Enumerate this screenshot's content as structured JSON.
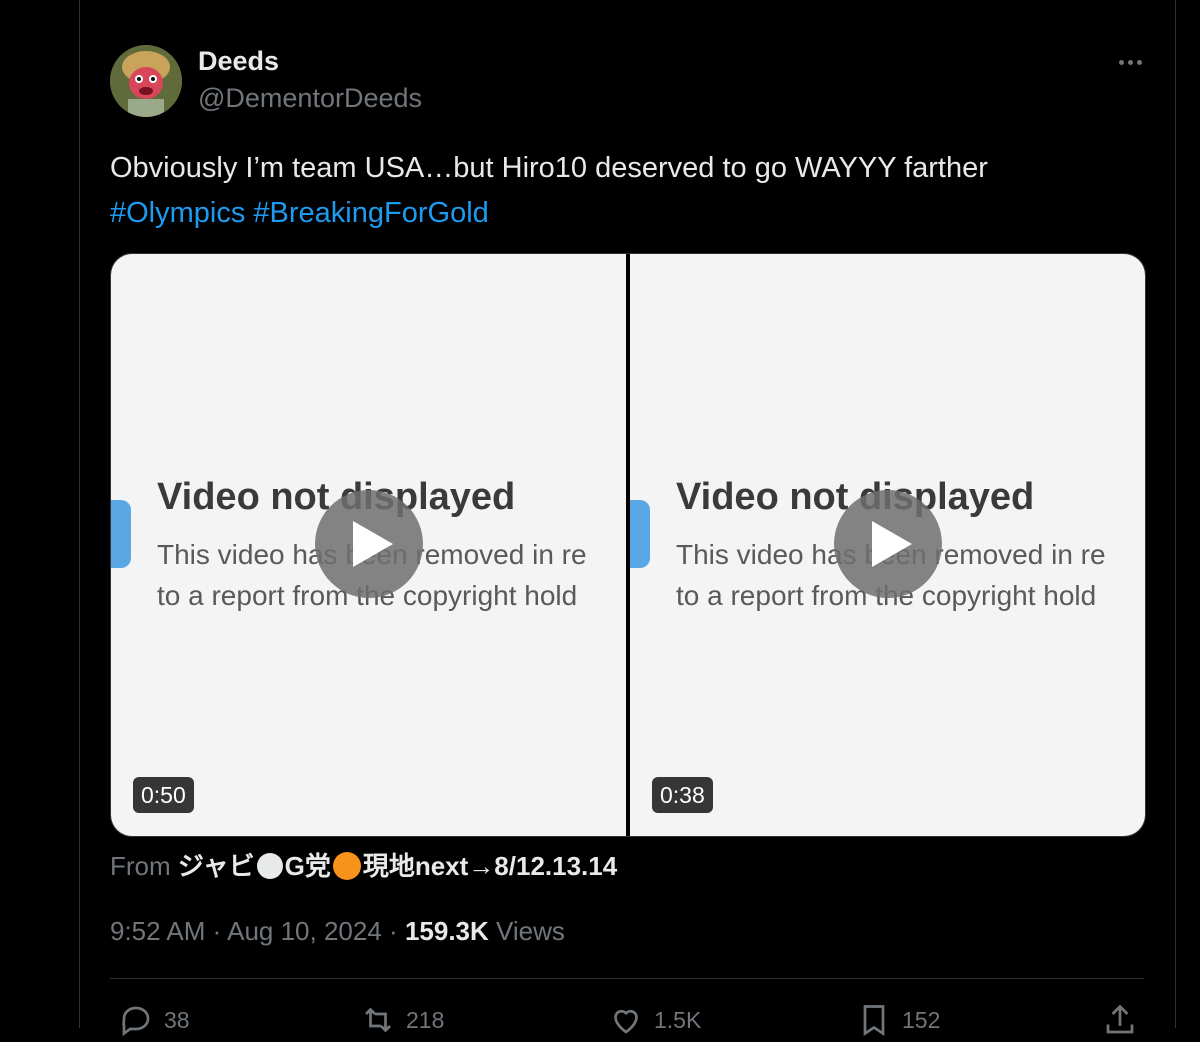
{
  "tweet": {
    "author": {
      "display_name": "Deeds",
      "handle": "@DementorDeeds"
    },
    "text": "Obviously I’m team USA…but Hiro10 deserved to go WAYYY farther",
    "hashtags": [
      "#Olympics",
      "#BreakingForGold"
    ],
    "media": [
      {
        "title": "Video not displayed",
        "body_line1": "This video has been removed in re",
        "body_line2": "to a report from the copyright hold",
        "duration": "0:50"
      },
      {
        "title": "Video not displayed",
        "body_line1": "This video has been removed in re",
        "body_line2": "to a report from the copyright hold",
        "duration": "0:38"
      }
    ],
    "from_label": "From",
    "from_source_part1": "ジャビ",
    "from_source_part2": "G党",
    "from_source_part3": "現地next→8/12.13.14",
    "time": "9:52 AM",
    "separator": "·",
    "date": "Aug 10, 2024",
    "views_count": "159.3K",
    "views_label": "Views",
    "actions": {
      "replies": "38",
      "reposts": "218",
      "likes": "1.5K",
      "bookmarks": "152"
    }
  },
  "colors": {
    "background": "#000000",
    "text": "#e7e9ea",
    "secondary": "#71767b",
    "link": "#1d9bf0",
    "border": "#2f3336"
  },
  "icons": [
    "more-icon",
    "play-icon",
    "reply-icon",
    "repost-icon",
    "like-icon",
    "bookmark-icon",
    "share-icon"
  ]
}
